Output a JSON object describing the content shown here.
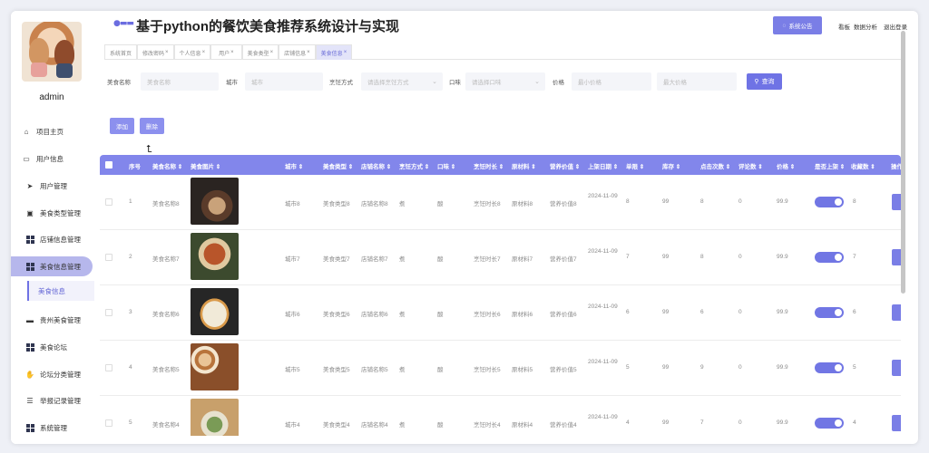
{
  "header": {
    "title": "基于python的餐饮美食推荐系统设计与实现",
    "notice_label": "系统公告",
    "links": [
      "看板",
      "数据分析",
      "退出登录"
    ]
  },
  "sidebar": {
    "username": "admin",
    "items": [
      {
        "label": "项目主页"
      },
      {
        "label": "用户信息"
      },
      {
        "label": "用户管理"
      },
      {
        "label": "美食类型管理"
      },
      {
        "label": "店铺信息管理"
      },
      {
        "label": "美食信息管理"
      },
      {
        "label": "美食信息"
      },
      {
        "label": "贵州美食管理"
      },
      {
        "label": "美食论坛"
      },
      {
        "label": "论坛分类管理"
      },
      {
        "label": "举报记录管理"
      },
      {
        "label": "系统管理"
      }
    ]
  },
  "tabs": [
    {
      "label": "系统首页",
      "close": ""
    },
    {
      "label": "修改密码",
      "close": "×"
    },
    {
      "label": "个人信息",
      "close": "×"
    },
    {
      "label": "用户",
      "close": "×"
    },
    {
      "label": "美食类型",
      "close": "×"
    },
    {
      "label": "店铺信息",
      "close": "×"
    },
    {
      "label": "美食信息",
      "close": "×"
    }
  ],
  "search": {
    "name_label": "美食名称",
    "name_placeholder": "美食名称",
    "city_label": "城市",
    "city_placeholder": "城市",
    "method_label": "烹饪方式",
    "method_placeholder": "请选择烹饪方式",
    "taste_label": "口味",
    "taste_placeholder": "请选择口味",
    "price_label": "价格",
    "price_min_placeholder": "最小价格",
    "price_max_placeholder": "最大价格",
    "query_label": "查询"
  },
  "actions": {
    "add": "添加",
    "delete": "删除"
  },
  "table": {
    "headers": [
      "序号",
      "美食名称 ⇕",
      "美食图片 ⇕",
      "城市 ⇕",
      "美食类型 ⇕",
      "店铺名称 ⇕",
      "烹饪方式 ⇕",
      "口味 ⇕",
      "烹饪时长 ⇕",
      "原材料 ⇕",
      "营养价值 ⇕",
      "上架日期 ⇕",
      "库存 ⇕",
      "单限 ⇕",
      "点击次数 ⇕",
      "评论数 ⇕",
      "价格 ⇕",
      "是否上架 ⇕",
      "收藏数 ⇕",
      "操作"
    ],
    "rows": [
      {
        "idx": "1",
        "name": "美食名称8",
        "city": "城市8",
        "type": "美食类型8",
        "shop": "店铺名称8",
        "method": "煮",
        "taste": "酸",
        "duration": "烹饪时长8",
        "material": "原材料8",
        "nutrition": "营养价值8",
        "date": "2024-11-09",
        "limit": "8",
        "stock": "99",
        "clicks": "8",
        "comments": "0",
        "price": "99.9",
        "fav": "8",
        "img": "dish-dark"
      },
      {
        "idx": "2",
        "name": "美食名称7",
        "city": "城市7",
        "type": "美食类型7",
        "shop": "店铺名称7",
        "method": "煮",
        "taste": "酸",
        "duration": "烹饪时长7",
        "material": "原材料7",
        "nutrition": "营养价值7",
        "date": "2024-11-09",
        "limit": "7",
        "stock": "99",
        "clicks": "8",
        "comments": "0",
        "price": "99.9",
        "fav": "7",
        "img": "roast"
      },
      {
        "idx": "3",
        "name": "美食名称6",
        "city": "城市6",
        "type": "美食类型6",
        "shop": "店铺名称6",
        "method": "煮",
        "taste": "酸",
        "duration": "烹饪时长6",
        "material": "原材料6",
        "nutrition": "营养价值6",
        "date": "2024-11-09",
        "limit": "6",
        "stock": "99",
        "clicks": "6",
        "comments": "0",
        "price": "99.9",
        "fav": "6",
        "img": "dumplings"
      },
      {
        "idx": "4",
        "name": "美食名称5",
        "city": "城市5",
        "type": "美食类型5",
        "shop": "店铺名称5",
        "method": "煮",
        "taste": "酸",
        "duration": "烹饪时长5",
        "material": "原材料5",
        "nutrition": "营养价值5",
        "date": "2024-11-09",
        "limit": "5",
        "stock": "99",
        "clicks": "9",
        "comments": "0",
        "price": "99.9",
        "fav": "5",
        "img": "buns"
      },
      {
        "idx": "5",
        "name": "美食名称4",
        "city": "城市4",
        "type": "美食类型4",
        "shop": "店铺名称4",
        "method": "煮",
        "taste": "酸",
        "duration": "烹饪时长4",
        "material": "原材料4",
        "nutrition": "营养价值4",
        "date": "2024-11-09",
        "limit": "4",
        "stock": "99",
        "clicks": "7",
        "comments": "0",
        "price": "99.9",
        "fav": "4",
        "img": "soup"
      }
    ]
  },
  "colors": {
    "accent": "#7a7ee6",
    "header_bg": "#8286eb",
    "active_nav": "#b6b7ec"
  }
}
